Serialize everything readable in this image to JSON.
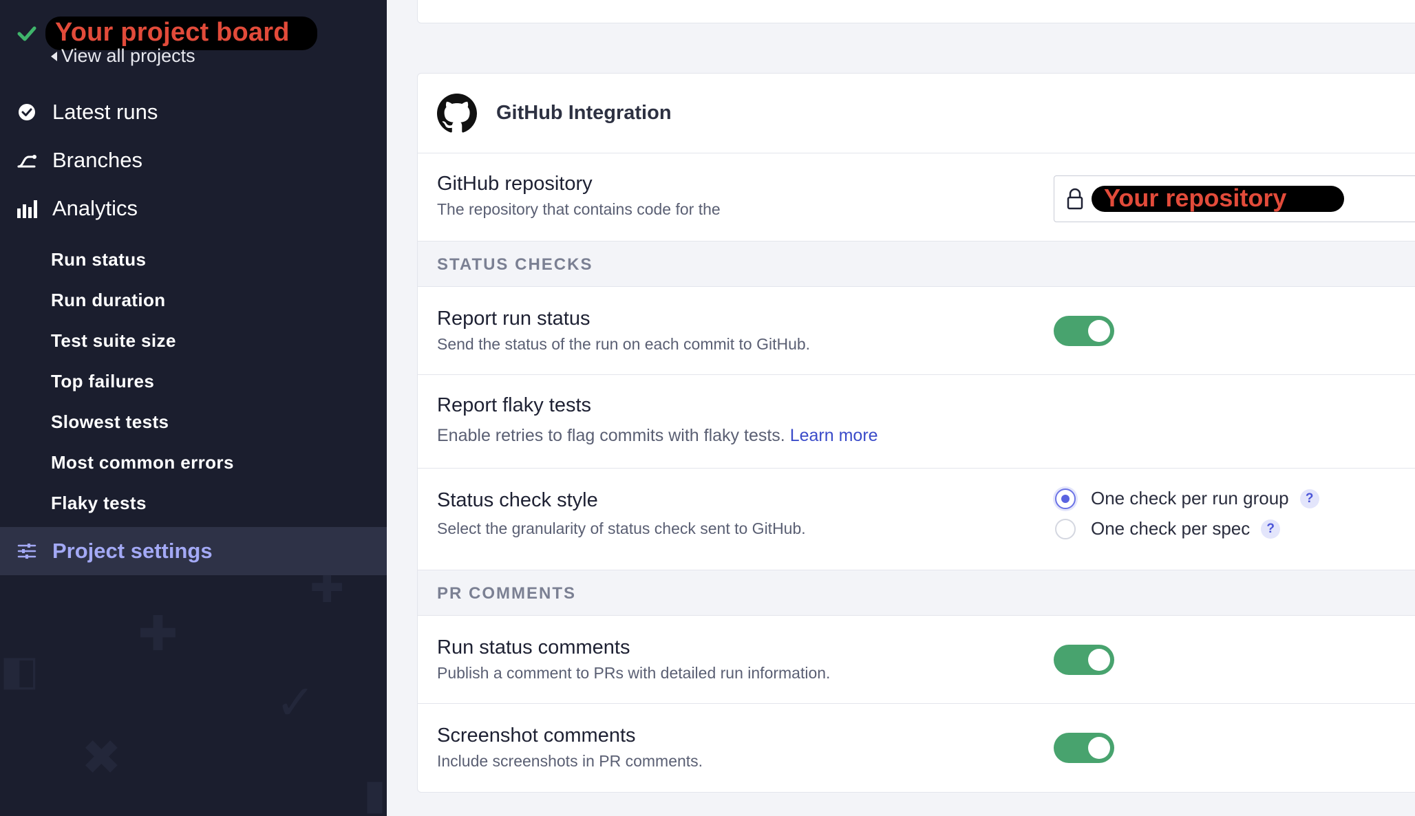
{
  "sidebar": {
    "project_name": "Your project board",
    "view_all_label": "View all projects",
    "nav": {
      "latest_runs": "Latest runs",
      "branches": "Branches",
      "analytics": "Analytics"
    },
    "analytics_items": [
      "Run status",
      "Run duration",
      "Test suite size",
      "Top failures",
      "Slowest tests",
      "Most common errors",
      "Flaky tests"
    ],
    "project_settings": "Project settings"
  },
  "github": {
    "title": "GitHub Integration",
    "repository": {
      "title": "GitHub repository",
      "description": "The repository that contains code for the",
      "value": "Your repository"
    },
    "status_checks": {
      "section_label": "STATUS CHECKS",
      "report_run_status": {
        "title": "Report run status",
        "description": "Send the status of the run on each commit to GitHub.",
        "enabled": true
      },
      "report_flaky_tests": {
        "title": "Report flaky tests",
        "description": "Enable retries to flag commits with flaky tests.",
        "link": "Learn more"
      },
      "status_check_style": {
        "title": "Status check style",
        "description": "Select the granularity of status check sent to GitHub.",
        "options": [
          "One check per run group",
          "One check per spec"
        ],
        "selected": "One check per run group",
        "help_icon": "?"
      }
    },
    "pr_comments": {
      "section_label": "PR COMMENTS",
      "run_status_comments": {
        "title": "Run status comments",
        "description": "Publish a comment to PRs with detailed run information.",
        "enabled": true
      },
      "screenshot_comments": {
        "title": "Screenshot comments",
        "description": "Include screenshots in PR comments.",
        "enabled": true
      }
    }
  },
  "colors": {
    "sidebar_bg": "#1b1e2e",
    "active_row_bg": "#2e3247",
    "active_text": "#a3a9f5",
    "check_green": "#3fb56b",
    "toggle_on": "#48a36e",
    "link": "#3a4bc9",
    "redaction_text": "#e24b3a"
  }
}
